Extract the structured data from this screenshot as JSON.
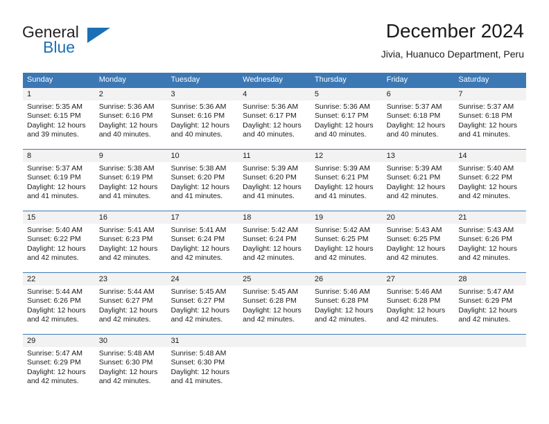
{
  "brand": {
    "name_top": "General",
    "name_bottom": "Blue",
    "accent_color": "#1A6FB5"
  },
  "header": {
    "title": "December 2024",
    "subtitle": "Jivia, Huanuco Department, Peru"
  },
  "calendar": {
    "header_bg_color": "#3C78B4",
    "day_number_bg_color": "#F2F2F2",
    "weekdays": [
      "Sunday",
      "Monday",
      "Tuesday",
      "Wednesday",
      "Thursday",
      "Friday",
      "Saturday"
    ],
    "weeks": [
      [
        {
          "day": "1",
          "sunrise": "Sunrise: 5:35 AM",
          "sunset": "Sunset: 6:15 PM",
          "daylight_1": "Daylight: 12 hours",
          "daylight_2": "and 39 minutes."
        },
        {
          "day": "2",
          "sunrise": "Sunrise: 5:36 AM",
          "sunset": "Sunset: 6:16 PM",
          "daylight_1": "Daylight: 12 hours",
          "daylight_2": "and 40 minutes."
        },
        {
          "day": "3",
          "sunrise": "Sunrise: 5:36 AM",
          "sunset": "Sunset: 6:16 PM",
          "daylight_1": "Daylight: 12 hours",
          "daylight_2": "and 40 minutes."
        },
        {
          "day": "4",
          "sunrise": "Sunrise: 5:36 AM",
          "sunset": "Sunset: 6:17 PM",
          "daylight_1": "Daylight: 12 hours",
          "daylight_2": "and 40 minutes."
        },
        {
          "day": "5",
          "sunrise": "Sunrise: 5:36 AM",
          "sunset": "Sunset: 6:17 PM",
          "daylight_1": "Daylight: 12 hours",
          "daylight_2": "and 40 minutes."
        },
        {
          "day": "6",
          "sunrise": "Sunrise: 5:37 AM",
          "sunset": "Sunset: 6:18 PM",
          "daylight_1": "Daylight: 12 hours",
          "daylight_2": "and 40 minutes."
        },
        {
          "day": "7",
          "sunrise": "Sunrise: 5:37 AM",
          "sunset": "Sunset: 6:18 PM",
          "daylight_1": "Daylight: 12 hours",
          "daylight_2": "and 41 minutes."
        }
      ],
      [
        {
          "day": "8",
          "sunrise": "Sunrise: 5:37 AM",
          "sunset": "Sunset: 6:19 PM",
          "daylight_1": "Daylight: 12 hours",
          "daylight_2": "and 41 minutes."
        },
        {
          "day": "9",
          "sunrise": "Sunrise: 5:38 AM",
          "sunset": "Sunset: 6:19 PM",
          "daylight_1": "Daylight: 12 hours",
          "daylight_2": "and 41 minutes."
        },
        {
          "day": "10",
          "sunrise": "Sunrise: 5:38 AM",
          "sunset": "Sunset: 6:20 PM",
          "daylight_1": "Daylight: 12 hours",
          "daylight_2": "and 41 minutes."
        },
        {
          "day": "11",
          "sunrise": "Sunrise: 5:39 AM",
          "sunset": "Sunset: 6:20 PM",
          "daylight_1": "Daylight: 12 hours",
          "daylight_2": "and 41 minutes."
        },
        {
          "day": "12",
          "sunrise": "Sunrise: 5:39 AM",
          "sunset": "Sunset: 6:21 PM",
          "daylight_1": "Daylight: 12 hours",
          "daylight_2": "and 41 minutes."
        },
        {
          "day": "13",
          "sunrise": "Sunrise: 5:39 AM",
          "sunset": "Sunset: 6:21 PM",
          "daylight_1": "Daylight: 12 hours",
          "daylight_2": "and 42 minutes."
        },
        {
          "day": "14",
          "sunrise": "Sunrise: 5:40 AM",
          "sunset": "Sunset: 6:22 PM",
          "daylight_1": "Daylight: 12 hours",
          "daylight_2": "and 42 minutes."
        }
      ],
      [
        {
          "day": "15",
          "sunrise": "Sunrise: 5:40 AM",
          "sunset": "Sunset: 6:22 PM",
          "daylight_1": "Daylight: 12 hours",
          "daylight_2": "and 42 minutes."
        },
        {
          "day": "16",
          "sunrise": "Sunrise: 5:41 AM",
          "sunset": "Sunset: 6:23 PM",
          "daylight_1": "Daylight: 12 hours",
          "daylight_2": "and 42 minutes."
        },
        {
          "day": "17",
          "sunrise": "Sunrise: 5:41 AM",
          "sunset": "Sunset: 6:24 PM",
          "daylight_1": "Daylight: 12 hours",
          "daylight_2": "and 42 minutes."
        },
        {
          "day": "18",
          "sunrise": "Sunrise: 5:42 AM",
          "sunset": "Sunset: 6:24 PM",
          "daylight_1": "Daylight: 12 hours",
          "daylight_2": "and 42 minutes."
        },
        {
          "day": "19",
          "sunrise": "Sunrise: 5:42 AM",
          "sunset": "Sunset: 6:25 PM",
          "daylight_1": "Daylight: 12 hours",
          "daylight_2": "and 42 minutes."
        },
        {
          "day": "20",
          "sunrise": "Sunrise: 5:43 AM",
          "sunset": "Sunset: 6:25 PM",
          "daylight_1": "Daylight: 12 hours",
          "daylight_2": "and 42 minutes."
        },
        {
          "day": "21",
          "sunrise": "Sunrise: 5:43 AM",
          "sunset": "Sunset: 6:26 PM",
          "daylight_1": "Daylight: 12 hours",
          "daylight_2": "and 42 minutes."
        }
      ],
      [
        {
          "day": "22",
          "sunrise": "Sunrise: 5:44 AM",
          "sunset": "Sunset: 6:26 PM",
          "daylight_1": "Daylight: 12 hours",
          "daylight_2": "and 42 minutes."
        },
        {
          "day": "23",
          "sunrise": "Sunrise: 5:44 AM",
          "sunset": "Sunset: 6:27 PM",
          "daylight_1": "Daylight: 12 hours",
          "daylight_2": "and 42 minutes."
        },
        {
          "day": "24",
          "sunrise": "Sunrise: 5:45 AM",
          "sunset": "Sunset: 6:27 PM",
          "daylight_1": "Daylight: 12 hours",
          "daylight_2": "and 42 minutes."
        },
        {
          "day": "25",
          "sunrise": "Sunrise: 5:45 AM",
          "sunset": "Sunset: 6:28 PM",
          "daylight_1": "Daylight: 12 hours",
          "daylight_2": "and 42 minutes."
        },
        {
          "day": "26",
          "sunrise": "Sunrise: 5:46 AM",
          "sunset": "Sunset: 6:28 PM",
          "daylight_1": "Daylight: 12 hours",
          "daylight_2": "and 42 minutes."
        },
        {
          "day": "27",
          "sunrise": "Sunrise: 5:46 AM",
          "sunset": "Sunset: 6:28 PM",
          "daylight_1": "Daylight: 12 hours",
          "daylight_2": "and 42 minutes."
        },
        {
          "day": "28",
          "sunrise": "Sunrise: 5:47 AM",
          "sunset": "Sunset: 6:29 PM",
          "daylight_1": "Daylight: 12 hours",
          "daylight_2": "and 42 minutes."
        }
      ],
      [
        {
          "day": "29",
          "sunrise": "Sunrise: 5:47 AM",
          "sunset": "Sunset: 6:29 PM",
          "daylight_1": "Daylight: 12 hours",
          "daylight_2": "and 42 minutes."
        },
        {
          "day": "30",
          "sunrise": "Sunrise: 5:48 AM",
          "sunset": "Sunset: 6:30 PM",
          "daylight_1": "Daylight: 12 hours",
          "daylight_2": "and 42 minutes."
        },
        {
          "day": "31",
          "sunrise": "Sunrise: 5:48 AM",
          "sunset": "Sunset: 6:30 PM",
          "daylight_1": "Daylight: 12 hours",
          "daylight_2": "and 41 minutes."
        },
        {
          "day": "",
          "sunrise": "",
          "sunset": "",
          "daylight_1": "",
          "daylight_2": ""
        },
        {
          "day": "",
          "sunrise": "",
          "sunset": "",
          "daylight_1": "",
          "daylight_2": ""
        },
        {
          "day": "",
          "sunrise": "",
          "sunset": "",
          "daylight_1": "",
          "daylight_2": ""
        },
        {
          "day": "",
          "sunrise": "",
          "sunset": "",
          "daylight_1": "",
          "daylight_2": ""
        }
      ]
    ]
  }
}
